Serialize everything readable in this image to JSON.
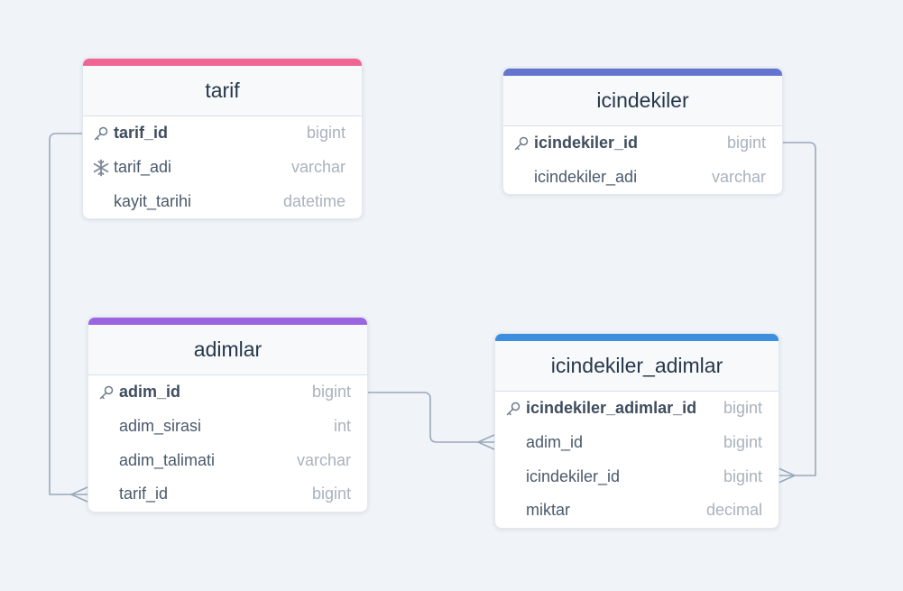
{
  "colors": {
    "tarif": "#f16592",
    "icindekiler": "#6475cf",
    "adimlar": "#9b64e2",
    "icindekiler_adimlar": "#3b8fde",
    "connector": "#9aa8ba"
  },
  "tables": {
    "tarif": {
      "name": "tarif",
      "fields": [
        {
          "name": "tarif_id",
          "type": "bigint",
          "icon": "key-icon",
          "pk": true
        },
        {
          "name": "tarif_adi",
          "type": "varchar",
          "icon": "snowflake-icon",
          "pk": false
        },
        {
          "name": "kayit_tarihi",
          "type": "datetime",
          "icon": "",
          "pk": false
        }
      ]
    },
    "icindekiler": {
      "name": "icindekiler",
      "fields": [
        {
          "name": "icindekiler_id",
          "type": "bigint",
          "icon": "key-icon",
          "pk": true
        },
        {
          "name": "icindekiler_adi",
          "type": "varchar",
          "icon": "",
          "pk": false
        }
      ]
    },
    "adimlar": {
      "name": "adimlar",
      "fields": [
        {
          "name": "adim_id",
          "type": "bigint",
          "icon": "key-icon",
          "pk": true
        },
        {
          "name": "adim_sirasi",
          "type": "int",
          "icon": "",
          "pk": false
        },
        {
          "name": "adim_talimati",
          "type": "varchar",
          "icon": "",
          "pk": false
        },
        {
          "name": "tarif_id",
          "type": "bigint",
          "icon": "",
          "pk": false
        }
      ]
    },
    "icindekiler_adimlar": {
      "name": "icindekiler_adimlar",
      "fields": [
        {
          "name": "icindekiler_adimlar_id",
          "type": "bigint",
          "icon": "key-icon",
          "pk": true
        },
        {
          "name": "adim_id",
          "type": "bigint",
          "icon": "",
          "pk": false
        },
        {
          "name": "icindekiler_id",
          "type": "bigint",
          "icon": "",
          "pk": false
        },
        {
          "name": "miktar",
          "type": "decimal",
          "icon": "",
          "pk": false
        }
      ]
    }
  }
}
